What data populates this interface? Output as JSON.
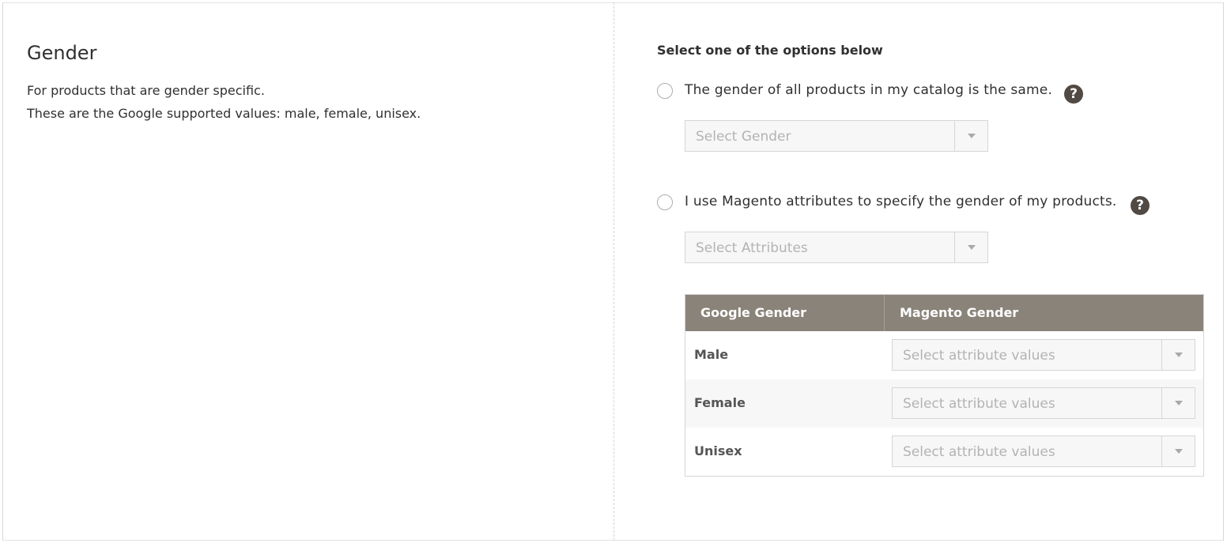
{
  "section": {
    "title": "Gender",
    "description_lines": [
      "For products that are gender specific.",
      "These are the Google supported values: male, female, unisex."
    ]
  },
  "options": {
    "instruction": "Select one of the options below",
    "option_same": {
      "label": "The gender of all products in my catalog is the same.",
      "selected": false,
      "select_placeholder": "Select Gender"
    },
    "option_attributes": {
      "label": "I use Magento attributes to specify the gender of my products.",
      "selected": false,
      "select_placeholder": "Select Attributes"
    },
    "help_glyph": "?"
  },
  "mapping_table": {
    "headers": [
      "Google Gender",
      "Magento Gender"
    ],
    "rows": [
      {
        "google": "Male",
        "placeholder": "Select attribute values"
      },
      {
        "google": "Female",
        "placeholder": "Select attribute values"
      },
      {
        "google": "Unisex",
        "placeholder": "Select attribute values"
      }
    ]
  },
  "colors": {
    "header_bg": "#8a837a",
    "help_bg": "#514943",
    "select_bg": "#f7f7f7"
  }
}
